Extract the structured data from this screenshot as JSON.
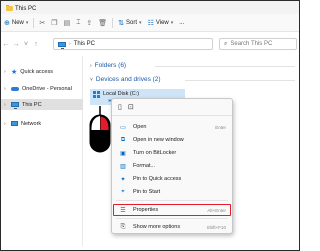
{
  "window": {
    "title": "This PC"
  },
  "toolbar": {
    "new_label": "New",
    "sort_label": "Sort",
    "view_label": "View",
    "more_label": "..."
  },
  "address": {
    "path": "This PC",
    "search_placeholder": "Search This PC"
  },
  "sidebar": {
    "items": [
      {
        "label": "Quick access",
        "icon": "star-icon"
      },
      {
        "label": "OneDrive - Personal",
        "icon": "cloud-icon"
      },
      {
        "label": "This PC",
        "icon": "pc-icon",
        "active": true
      },
      {
        "label": "Network",
        "icon": "network-icon"
      }
    ]
  },
  "main": {
    "folders_group": "Folders (6)",
    "devices_group": "Devices and drives (2)",
    "drive": {
      "label": "Local Disk (C:)"
    }
  },
  "context_menu": {
    "items": [
      {
        "label": "Open",
        "shortcut": "Enter",
        "icon": "open-icon"
      },
      {
        "label": "Open in new window",
        "shortcut": "",
        "icon": "new-window-icon"
      },
      {
        "label": "Turn on BitLocker",
        "shortcut": "",
        "icon": "bitlocker-icon"
      },
      {
        "label": "Format...",
        "shortcut": "",
        "icon": "format-icon"
      },
      {
        "label": "Pin to Quick access",
        "shortcut": "",
        "icon": "pin-icon"
      },
      {
        "label": "Pin to Start",
        "shortcut": "",
        "icon": "pin-start-icon"
      },
      {
        "label": "Properties",
        "shortcut": "Alt+Enter",
        "icon": "properties-icon"
      },
      {
        "label": "Show more options",
        "shortcut": "Shift+F10",
        "icon": "more-options-icon"
      }
    ]
  },
  "colors": {
    "accent": "#0067c0",
    "highlight_box": "#e41b2a",
    "selected_drive": "#cfe4f7"
  }
}
